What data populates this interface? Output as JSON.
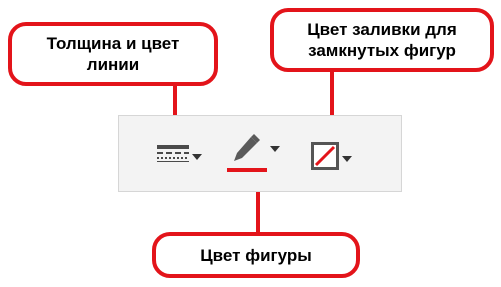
{
  "callouts": {
    "line_width_color": {
      "line1": "Толщина и цвет",
      "line2": "линии"
    },
    "fill_color": {
      "line1": "Цвет заливки для",
      "line2": "замкнутых фигур"
    },
    "shape_color": {
      "label": "Цвет фигуры"
    }
  },
  "toolbar": {
    "tools": [
      {
        "name": "line-style",
        "icon": "line-style-icon",
        "has_dropdown": true
      },
      {
        "name": "pen-color",
        "icon": "pen-icon",
        "has_dropdown": true,
        "color": "#e3141a"
      },
      {
        "name": "fill-color",
        "icon": "no-fill-icon",
        "has_dropdown": true
      }
    ]
  },
  "colors": {
    "accent": "#e3141a",
    "toolbar_bg": "#f3f3f3",
    "toolbar_border": "#d6d6d6",
    "icon": "#4a4a4a"
  }
}
